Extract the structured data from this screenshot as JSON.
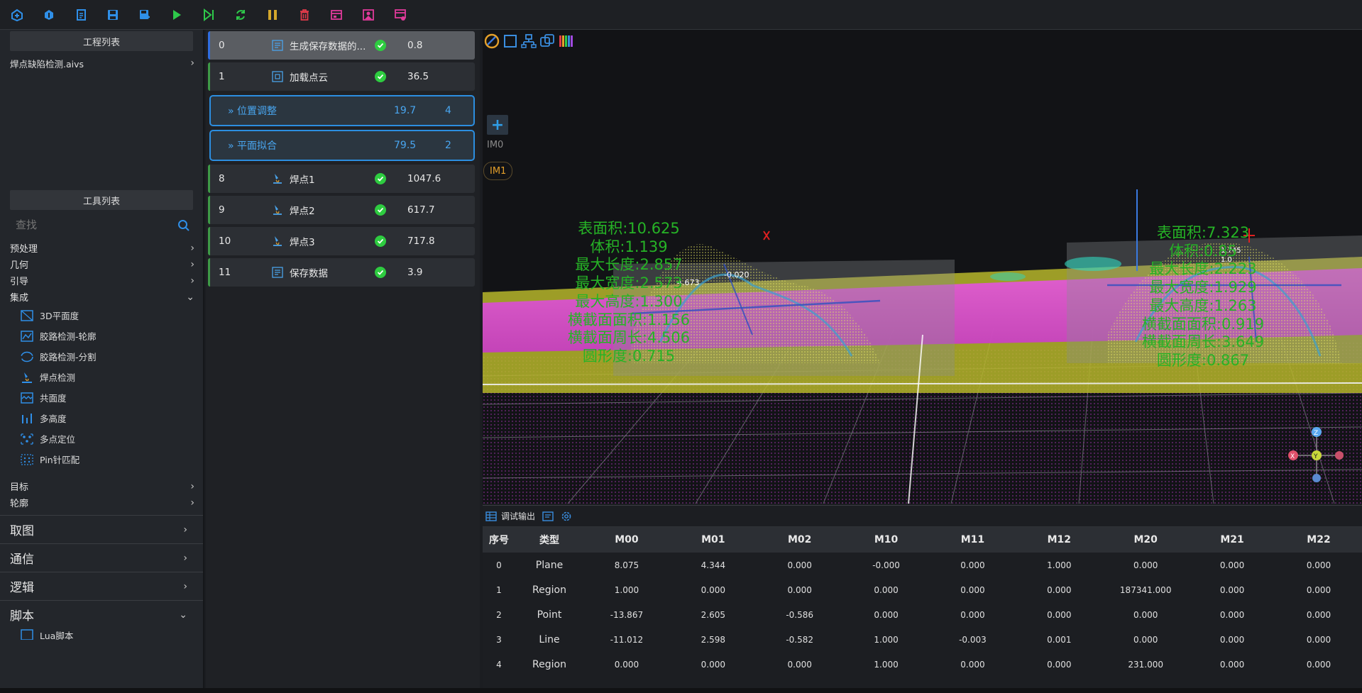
{
  "toolbar": {
    "buttons": [
      {
        "icon": "open-project-icon",
        "color": "#2f8fe8"
      },
      {
        "icon": "import-icon",
        "color": "#2f8fe8"
      },
      {
        "icon": "new-file-icon",
        "color": "#2f8fe8"
      },
      {
        "icon": "save-icon",
        "color": "#2f8fe8"
      },
      {
        "icon": "save-as-icon",
        "color": "#2f8fe8"
      },
      {
        "icon": "run-icon",
        "color": "#2ec94a"
      },
      {
        "icon": "step-run-icon",
        "color": "#2ec94a"
      },
      {
        "icon": "loop-run-icon",
        "color": "#2ec94a"
      },
      {
        "icon": "pause-icon",
        "color": "#d4a72c"
      },
      {
        "icon": "delete-icon",
        "color": "#e03a4a"
      },
      {
        "icon": "window-icon",
        "color": "#e03a9a"
      },
      {
        "icon": "image-icon",
        "color": "#e03a9a"
      },
      {
        "icon": "settings-panel-icon",
        "color": "#e03a9a"
      }
    ]
  },
  "left": {
    "project_title": "工程列表",
    "project_file": "焊点缺陷检测.aivs",
    "tools_title": "工具列表",
    "search_placeholder": "查找",
    "categories_top": [
      "预处理",
      "几何",
      "引导"
    ],
    "open_category": "集成",
    "tools": [
      "3D平面度",
      "胶路检测-轮廓",
      "胶路检测-分割",
      "焊点检测",
      "共面度",
      "多高度",
      "多点定位",
      "Pin针匹配"
    ],
    "categories_bottom": [
      "目标",
      "轮廓"
    ],
    "big_sections": [
      "取图",
      "通信",
      "逻辑",
      "脚本"
    ],
    "script_item": "Lua脚本"
  },
  "flow": {
    "steps_top": [
      {
        "index": "0",
        "name": "生成保存数据的...",
        "time": "0.8",
        "icon": "script-icon"
      },
      {
        "index": "1",
        "name": "加载点云",
        "time": "36.5",
        "icon": "load-cloud-icon"
      }
    ],
    "groups": [
      {
        "name": "位置调整",
        "time": "19.7",
        "count": "4"
      },
      {
        "name": "平面拟合",
        "time": "79.5",
        "count": "2"
      }
    ],
    "steps_bottom": [
      {
        "index": "8",
        "name": "焊点1",
        "time": "1047.6",
        "icon": "weld-icon"
      },
      {
        "index": "9",
        "name": "焊点2",
        "time": "617.7",
        "icon": "weld-icon"
      },
      {
        "index": "10",
        "name": "焊点3",
        "time": "717.8",
        "icon": "weld-icon"
      },
      {
        "index": "11",
        "name": "保存数据",
        "time": "3.9",
        "icon": "save-data-icon"
      }
    ]
  },
  "viewer": {
    "image_labels": [
      "IM0",
      "IM1"
    ],
    "measure_left": [
      "表面积:10.625",
      "体积:1.139",
      "最大长度:2.857",
      "最大宽度:2.573",
      "最大高度:1.300",
      "横截面面积:1.156",
      "横截面周长:4.506",
      "圆形度:0.715"
    ],
    "measure_right": [
      "表面积:7.323",
      "体积:0.85",
      "最大长度:2.223",
      "最大宽度:1.929",
      "最大高度:1.263",
      "横截面面积:0.919",
      "横截面周长:3.649",
      "圆形度:0.867"
    ],
    "dim_labels": [
      "4.673",
      "-0.020",
      "1.745",
      "1.0"
    ],
    "axis_labels": [
      "Z",
      "X",
      "Y"
    ]
  },
  "debug": {
    "tab_label": "调试输出",
    "columns": [
      "序号",
      "类型",
      "M00",
      "M01",
      "M02",
      "M10",
      "M11",
      "M12",
      "M20",
      "M21",
      "M22"
    ],
    "rows": [
      [
        "0",
        "Plane",
        "8.075",
        "4.344",
        "0.000",
        "-0.000",
        "0.000",
        "1.000",
        "0.000",
        "0.000",
        "0.000"
      ],
      [
        "1",
        "Region",
        "1.000",
        "0.000",
        "0.000",
        "0.000",
        "0.000",
        "0.000",
        "187341.000",
        "0.000",
        "0.000"
      ],
      [
        "2",
        "Point",
        "-13.867",
        "2.605",
        "-0.586",
        "0.000",
        "0.000",
        "0.000",
        "0.000",
        "0.000",
        "0.000"
      ],
      [
        "3",
        "Line",
        "-11.012",
        "2.598",
        "-0.582",
        "1.000",
        "-0.003",
        "0.001",
        "0.000",
        "0.000",
        "0.000"
      ],
      [
        "4",
        "Region",
        "0.000",
        "0.000",
        "0.000",
        "1.000",
        "0.000",
        "0.000",
        "231.000",
        "0.000",
        "0.000"
      ]
    ]
  }
}
